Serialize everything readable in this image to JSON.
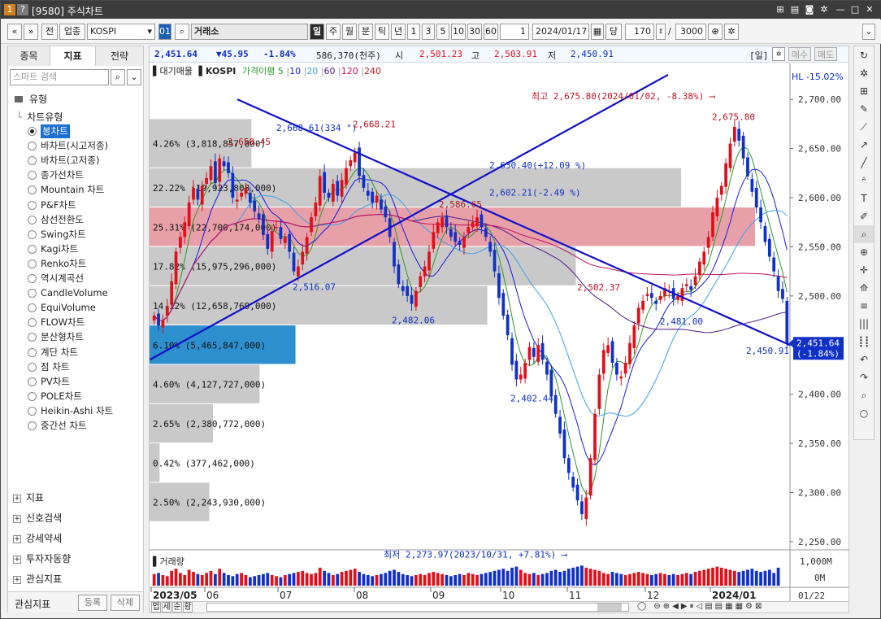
{
  "window": {
    "title": "[9580] 주식차트",
    "title_icons": [
      "1",
      "?"
    ]
  },
  "toolbar": {
    "nav_prev": "«",
    "nav_down": "»",
    "btn_jeon": "전",
    "btn_upjong": "업종",
    "symbol_value": "KOSPI",
    "symbol_tag": "01",
    "search_glyph": "⌕",
    "exchange_value": "거래소",
    "periods": [
      "일",
      "주",
      "월",
      "분",
      "틱",
      "년"
    ],
    "intervals": [
      "1",
      "3",
      "5",
      "10",
      "30",
      "60"
    ],
    "count_small": "1",
    "date_value": "2024/01/17",
    "dang_label": "당",
    "count_value": "170",
    "slash": "/",
    "max_value": "3000"
  },
  "left_panel": {
    "tabs": [
      "종목",
      "지표",
      "전략"
    ],
    "search_placeholder": "스마트 검색",
    "type_header": "유형",
    "chart_type_header": "차트유형",
    "chart_types": [
      "봉차트",
      "바차트(시고저종)",
      "바차트(고저종)",
      "종가선차트",
      "Mountain 차트",
      "P&F차트",
      "삼선전환도",
      "Swing차트",
      "Kagi차트",
      "Renko차트",
      "역시계곡선",
      "CandleVolume",
      "EquiVolume",
      "FLOW차트",
      "분산형차트",
      "계단 차트",
      "점 차트",
      "PV차트",
      "POLE차트",
      "Heikin-Ashi 차트",
      "중간선 차트"
    ],
    "selected_type": "봉차트",
    "sections": [
      "지표",
      "신호검색",
      "강세약세",
      "투자자동향",
      "관심지표"
    ],
    "footer_label": "관심지표",
    "footer_register": "등록",
    "footer_delete": "삭제"
  },
  "infobar": {
    "price": "2,451.64",
    "change": "▼45.95",
    "change_pct": "-1.84%",
    "volume": "586,370(천주)",
    "open_label": "시",
    "open": "2,501.23",
    "high_label": "고",
    "high": "2,503.91",
    "low_label": "저",
    "low": "2,450.91",
    "period_tag": "[일]",
    "buy": "매수",
    "sell": "매도"
  },
  "chart_header": {
    "legend_daegi": "대기매물",
    "legend_kospi": "KOSPI",
    "legend_ma_label": "가격이평",
    "ma_periods": [
      "5",
      "10",
      "20",
      "60",
      "120",
      "240"
    ],
    "hl_label": "HL -15.02%",
    "volume_label": "거래량"
  },
  "colors": {
    "up": "#e0101a",
    "down": "#1030c8",
    "trend": "#1010c8",
    "ma5": "#2a9a2a",
    "ma10": "#1818e0",
    "ma20": "#3aa0e8",
    "ma60": "#4b1a8a",
    "ma120": "#c01060",
    "ma240": "#c02020",
    "profile_gray": "#c9c9c9",
    "profile_pink": "#e8a0a8",
    "profile_blue": "#2d8fce",
    "axis_bg": "#fff",
    "last_box": "#1030c8"
  },
  "chart_data": {
    "type": "candlestick",
    "y_ticks": [
      "2,700.00",
      "2,650.00",
      "2,600.00",
      "2,550.00",
      "2,500.00",
      "2,450.00",
      "2,400.00",
      "2,350.00",
      "2,300.00",
      "2,250.00"
    ],
    "ylim": [
      2240,
      2720
    ],
    "x_ticks": [
      "2023/05",
      "06",
      "07",
      "08",
      "09",
      "10",
      "11",
      "12",
      "2024/01"
    ],
    "last_price_box": [
      "2,451.64",
      "(-1.84%)"
    ],
    "volume_ticks": [
      "1,000M",
      "0M"
    ],
    "date_label": "01/22",
    "volume_profile": [
      {
        "range": [
          2630,
          2680
        ],
        "label": "4.26% (3,818,857,000)",
        "tone": "gray",
        "pct": 4.26
      },
      {
        "range": [
          2590,
          2630
        ],
        "label": "22.22% (19,923,808,000)",
        "tone": "gray",
        "pct": 22.22
      },
      {
        "range": [
          2550,
          2590
        ],
        "label": "25.31% (22,700,174,000)",
        "tone": "pink",
        "pct": 25.31
      },
      {
        "range": [
          2510,
          2550
        ],
        "label": "17.82% (15,975,296,000)",
        "tone": "gray",
        "pct": 17.82
      },
      {
        "range": [
          2470,
          2510
        ],
        "label": "14.12% (12,658,769,000)",
        "tone": "gray",
        "pct": 14.12
      },
      {
        "range": [
          2430,
          2470
        ],
        "label": "6.10% (5,465,847,000)",
        "tone": "blue",
        "pct": 6.1
      },
      {
        "range": [
          2390,
          2430
        ],
        "label": "4.60% (4,127,727,000)",
        "tone": "gray",
        "pct": 4.6
      },
      {
        "range": [
          2350,
          2390
        ],
        "label": "2.65% (2,380,772,000)",
        "tone": "gray",
        "pct": 2.65
      },
      {
        "range": [
          2310,
          2350
        ],
        "label": "0.42% (377,462,000)",
        "tone": "gray",
        "pct": 0.42
      },
      {
        "range": [
          2270,
          2310
        ],
        "label": "2.50% (2,243,930,000)",
        "tone": "gray",
        "pct": 2.5
      }
    ],
    "annotations": {
      "max_label": "최고 2,675.80(2024/01/02, -8.38%)",
      "min_label": "최저 2,273.97(2023/10/31, +7.81%)",
      "trend1_label": "2,668.61(334 °)",
      "trend2a_label": "2,630.40(+12.09 %)",
      "trend2b_label": "2,602.21(-2.49 %)",
      "points": [
        {
          "text": "2,650.45",
          "v": 2650.45
        },
        {
          "text": "2,668.21",
          "v": 2668.21
        },
        {
          "text": "2,586.65",
          "v": 2586.65
        },
        {
          "text": "2,516.07",
          "v": 2516.07
        },
        {
          "text": "2,482.06",
          "v": 2482.06
        },
        {
          "text": "2,402.44",
          "v": 2402.44
        },
        {
          "text": "2,502.37",
          "v": 2502.37
        },
        {
          "text": "2,481.00",
          "v": 2481.0
        },
        {
          "text": "2,675.80",
          "v": 2675.8
        },
        {
          "text": "2,450.91",
          "v": 2450.91
        }
      ]
    },
    "closes": [
      2480,
      2470,
      2475,
      2490,
      2515,
      2545,
      2560,
      2575,
      2595,
      2610,
      2598,
      2612,
      2620,
      2632,
      2615,
      2640,
      2632,
      2625,
      2600,
      2598,
      2605,
      2610,
      2595,
      2586,
      2578,
      2562,
      2548,
      2566,
      2570,
      2558,
      2560,
      2545,
      2525,
      2530,
      2545,
      2560,
      2580,
      2595,
      2622,
      2605,
      2600,
      2614,
      2602,
      2618,
      2630,
      2638,
      2646,
      2622,
      2610,
      2602,
      2595,
      2602,
      2588,
      2580,
      2560,
      2530,
      2512,
      2505,
      2500,
      2492,
      2505,
      2520,
      2530,
      2545,
      2565,
      2575,
      2580,
      2570,
      2560,
      2555,
      2552,
      2560,
      2570,
      2575,
      2580,
      2570,
      2560,
      2545,
      2525,
      2498,
      2480,
      2460,
      2430,
      2415,
      2420,
      2432,
      2448,
      2438,
      2450,
      2435,
      2420,
      2398,
      2380,
      2360,
      2335,
      2320,
      2305,
      2292,
      2278,
      2295,
      2335,
      2380,
      2420,
      2445,
      2450,
      2432,
      2420,
      2418,
      2432,
      2452,
      2470,
      2488,
      2495,
      2502,
      2498,
      2492,
      2500,
      2508,
      2505,
      2497,
      2500,
      2508,
      2512,
      2506,
      2520,
      2535,
      2545,
      2560,
      2585,
      2600,
      2612,
      2635,
      2655,
      2672,
      2658,
      2640,
      2622,
      2606,
      2590,
      2575,
      2555,
      2540,
      2525,
      2505,
      2497,
      2452
    ],
    "volume_series_note": "volume bars per session, relative heights",
    "volumes": [
      0.55,
      0.6,
      0.5,
      0.45,
      0.7,
      0.8,
      0.6,
      0.5,
      0.75,
      0.65,
      0.55,
      0.5,
      0.6,
      0.7,
      0.55,
      0.8,
      0.6,
      0.5,
      0.45,
      0.55,
      0.6,
      0.5,
      0.4,
      0.45,
      0.5,
      0.55,
      0.6,
      0.5,
      0.45,
      0.4,
      0.5,
      0.55,
      0.6,
      0.65,
      0.7,
      0.6,
      0.55,
      0.6,
      0.85,
      0.7,
      0.6,
      0.5,
      0.55,
      0.65,
      0.7,
      0.75,
      0.8,
      0.65,
      0.55,
      0.5,
      0.45,
      0.5,
      0.55,
      0.6,
      0.7,
      0.75,
      0.65,
      0.55,
      0.5,
      0.45,
      0.5,
      0.55,
      0.5,
      0.6,
      0.65,
      0.6,
      0.55,
      0.5,
      0.45,
      0.5,
      0.55,
      0.5,
      0.6,
      0.55,
      0.5,
      0.55,
      0.6,
      0.65,
      0.7,
      0.75,
      0.8,
      0.7,
      0.85,
      0.9,
      0.75,
      0.6,
      0.55,
      0.6,
      0.5,
      0.55,
      0.6,
      0.7,
      0.75,
      0.65,
      0.7,
      0.8,
      0.85,
      0.9,
      0.95,
      0.85,
      0.8,
      0.75,
      0.7,
      0.6,
      0.55,
      0.65,
      0.6,
      0.55,
      0.5,
      0.55,
      0.6,
      0.65,
      0.6,
      0.55,
      0.5,
      0.55,
      0.6,
      0.55,
      0.5,
      0.55,
      0.5,
      0.55,
      0.6,
      0.55,
      0.65,
      0.7,
      0.75,
      0.8,
      0.85,
      0.9,
      0.85,
      0.8,
      0.75,
      0.7,
      0.65,
      0.7,
      0.75,
      0.8,
      0.7,
      0.65,
      0.7,
      0.75,
      0.6,
      0.85
    ]
  },
  "bottom": {
    "tabs": [
      "업",
      "세",
      "순",
      "황"
    ],
    "zoom_minus": "⊖",
    "zoom_plus": "⊕"
  }
}
